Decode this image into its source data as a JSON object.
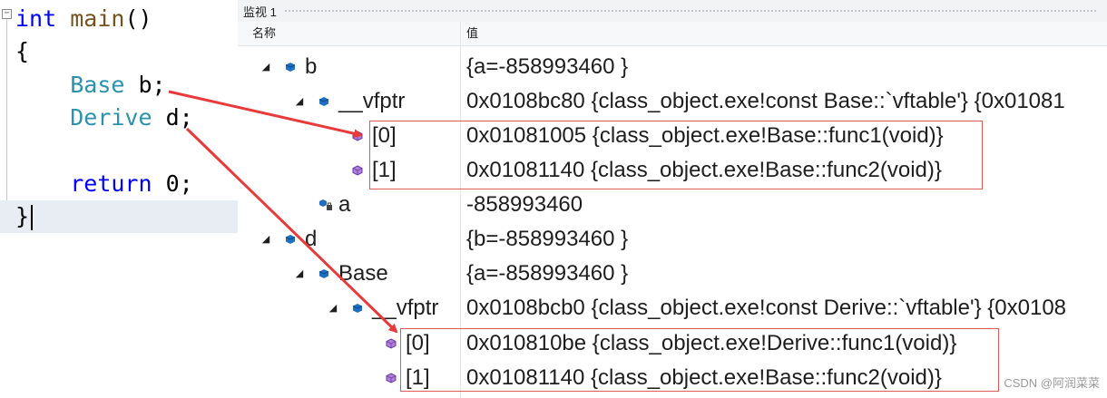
{
  "editor": {
    "collapse_glyph": "−",
    "lines": [
      {
        "parts": [
          {
            "t": "int",
            "c": "kw"
          },
          {
            "t": " "
          },
          {
            "t": "main",
            "c": "fn"
          },
          {
            "t": "()"
          }
        ]
      },
      {
        "parts": [
          {
            "t": "{"
          }
        ]
      },
      {
        "parts": [
          {
            "t": "    "
          },
          {
            "t": "Base",
            "c": "ty"
          },
          {
            "t": " b;"
          }
        ]
      },
      {
        "parts": [
          {
            "t": "    "
          },
          {
            "t": "Derive",
            "c": "ty"
          },
          {
            "t": " d;"
          }
        ]
      },
      {
        "parts": [
          {
            "t": ""
          }
        ]
      },
      {
        "parts": [
          {
            "t": "    "
          },
          {
            "t": "return",
            "c": "kw"
          },
          {
            "t": " 0;"
          }
        ]
      },
      {
        "parts": [
          {
            "t": "}"
          }
        ]
      }
    ]
  },
  "watch": {
    "title": "监视 1",
    "columns": {
      "name": "名称",
      "value": "值"
    },
    "rows": [
      {
        "name": "b",
        "value": "{a=-858993460 }",
        "expander": "◢",
        "icon": "object-icon"
      },
      {
        "name": "__vfptr",
        "value": "0x0108bc80 {class_object.exe!const Base::`vftable'} {0x01081",
        "expander": "◢",
        "icon": "object-icon"
      },
      {
        "name": "[0]",
        "value": "0x01081005 {class_object.exe!Base::func1(void)}",
        "expander": "",
        "icon": "method-icon"
      },
      {
        "name": "[1]",
        "value": "0x01081140 {class_object.exe!Base::func2(void)}",
        "expander": "",
        "icon": "method-icon"
      },
      {
        "name": "a",
        "value": "-858993460",
        "expander": "",
        "icon": "field-icon"
      },
      {
        "name": "d",
        "value": "{b=-858993460 }",
        "expander": "◢",
        "icon": "object-icon"
      },
      {
        "name": "Base",
        "value": "{a=-858993460 }",
        "expander": "◢",
        "icon": "object-icon"
      },
      {
        "name": "__vfptr",
        "value": "0x0108bcb0 {class_object.exe!const Derive::`vftable'} {0x0108",
        "expander": "◢",
        "icon": "object-icon"
      },
      {
        "name": "[0]",
        "value": "0x010810be {class_object.exe!Derive::func1(void)}",
        "expander": "",
        "icon": "method-icon"
      },
      {
        "name": "[1]",
        "value": "0x01081140 {class_object.exe!Base::func2(void)}",
        "expander": "",
        "icon": "method-icon"
      }
    ]
  },
  "annotation": {
    "color": "#e83a3a"
  },
  "watermark": "CSDN @阿润菜菜"
}
